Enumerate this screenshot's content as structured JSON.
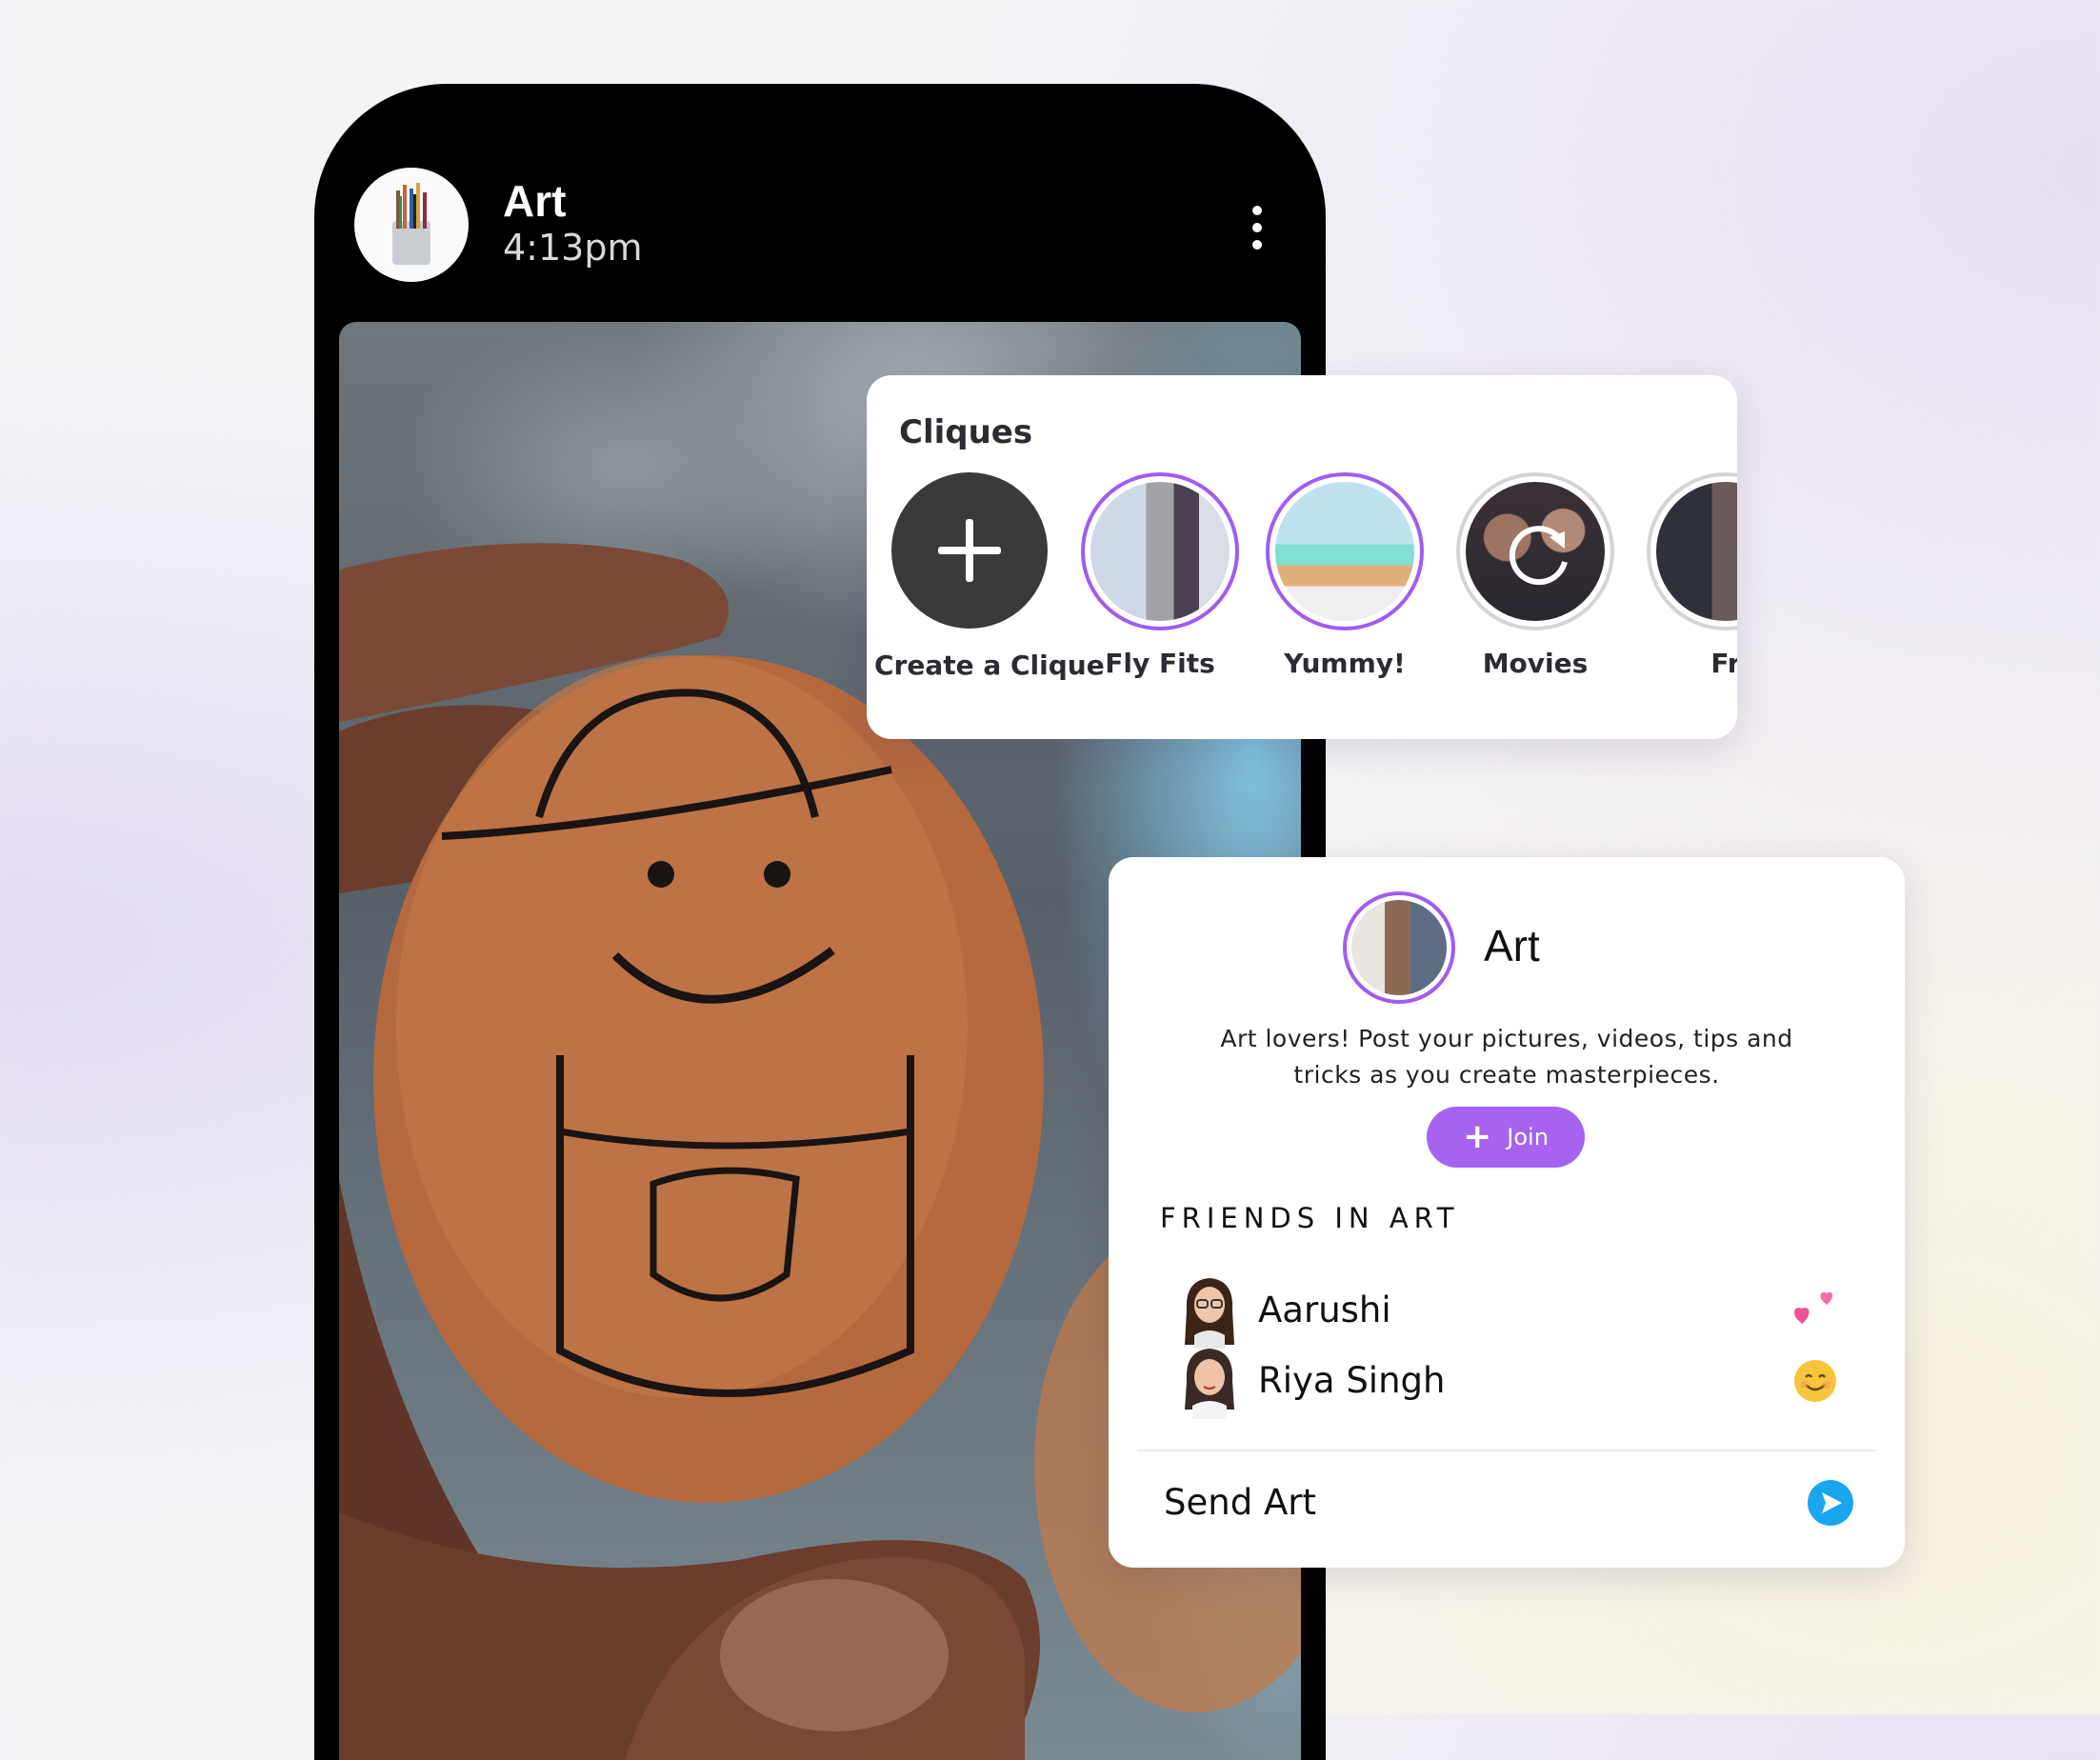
{
  "header": {
    "title": "Art",
    "time": "4:13pm",
    "avatar_icon": "paintbrushes-icon",
    "more_icon": "more-vertical-icon"
  },
  "cliques": {
    "title": "Cliques",
    "items": [
      {
        "label": "Create a Clique",
        "icon": "plus-icon"
      },
      {
        "label": "Fly Fits",
        "ring": "purple"
      },
      {
        "label": "Yummy!",
        "ring": "purple"
      },
      {
        "label": "Movies",
        "ring": "grey",
        "icon": "refresh-icon"
      },
      {
        "label": "Fr",
        "ring": "grey"
      }
    ]
  },
  "art_card": {
    "name": "Art",
    "description": "Art lovers! Post your pictures, videos, tips and tricks as you create masterpieces.",
    "join_label": "Join",
    "friends_heading": "FRIENDS IN ART",
    "friends": [
      {
        "name": "Aarushi",
        "emoji_icon": "two-hearts-icon"
      },
      {
        "name": "Riya Singh",
        "emoji_icon": "smiling-face-icon"
      }
    ],
    "send_label": "Send Art",
    "send_icon": "send-arrow-icon"
  },
  "colors": {
    "accent": "#a563ef",
    "send": "#1aa6ee"
  }
}
